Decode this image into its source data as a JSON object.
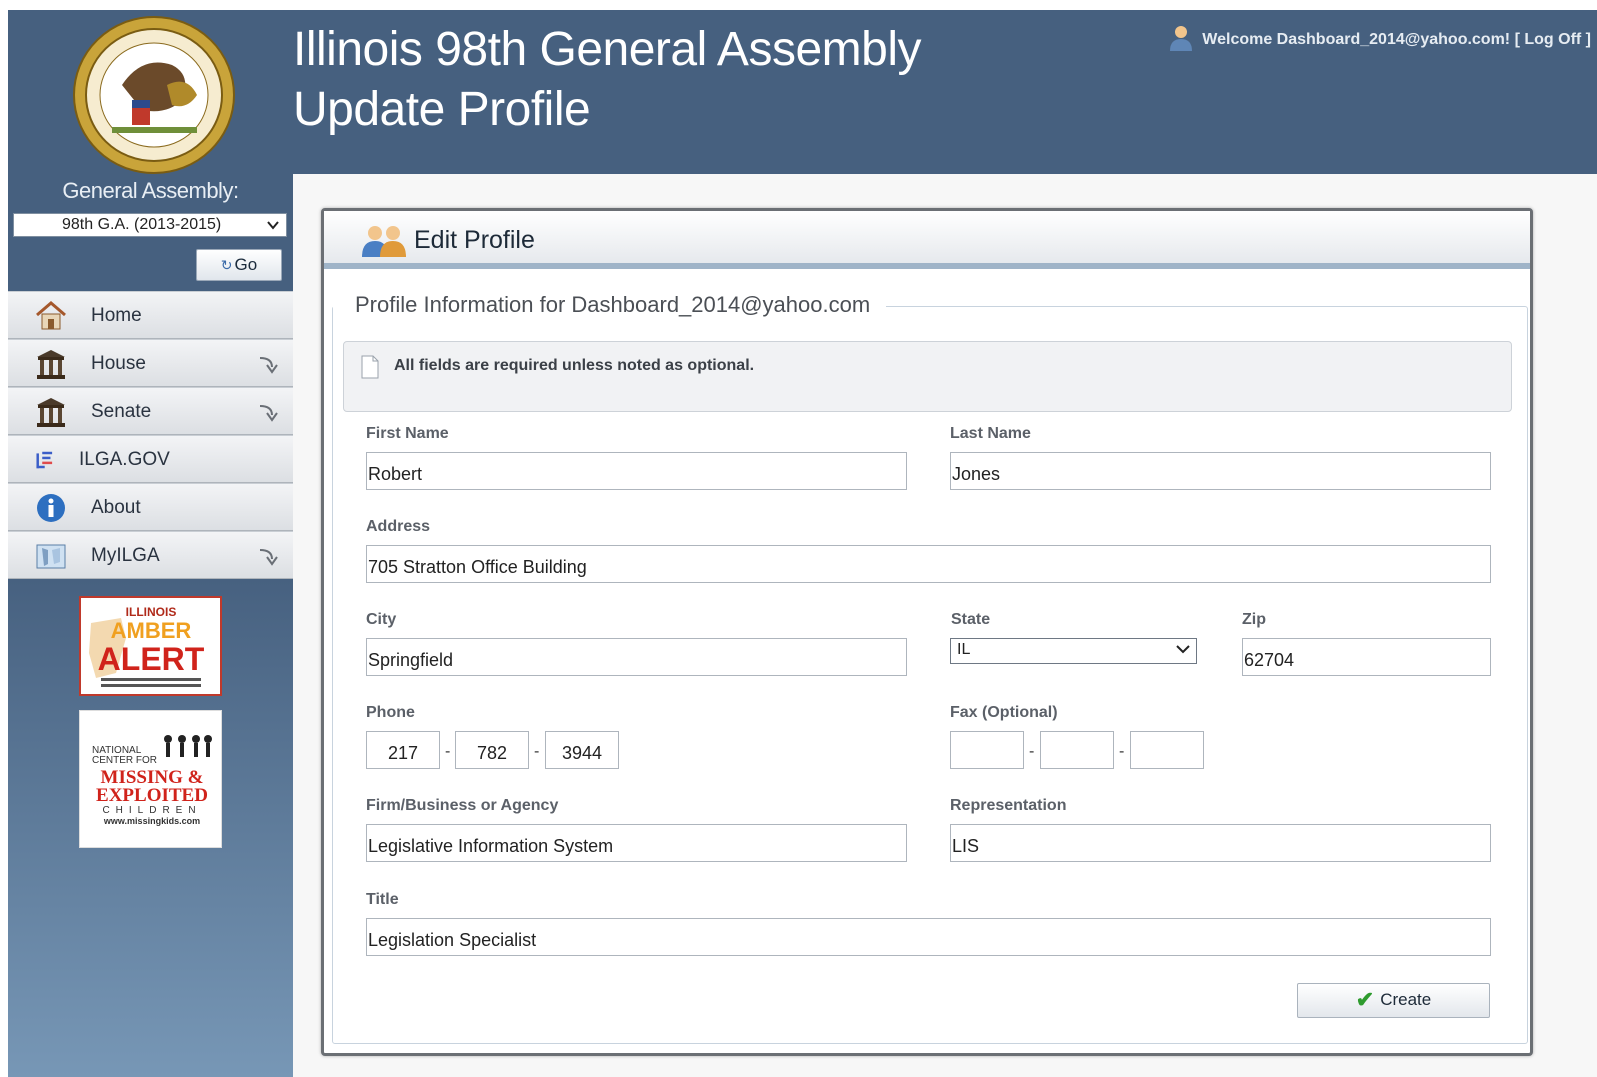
{
  "header": {
    "title_line1": "Illinois 98th General Assembly",
    "title_line2": "Update Profile",
    "welcome_text": "Welcome Dashboard_2014@yahoo.com! [ Log Off ]"
  },
  "sidebar": {
    "ga_label": "General Assembly:",
    "ga_selected": "98th G.A. (2013-2015)",
    "go_label": "Go",
    "nav": [
      {
        "label": "Home",
        "icon": "home-icon",
        "expandable": false
      },
      {
        "label": "House",
        "icon": "capitol-building-icon",
        "expandable": true
      },
      {
        "label": "Senate",
        "icon": "capitol-building-icon",
        "expandable": true
      },
      {
        "label": "ILGA.GOV",
        "icon": "ilga-logo-icon",
        "expandable": false
      },
      {
        "label": "About",
        "icon": "info-icon",
        "expandable": false
      },
      {
        "label": "MyILGA",
        "icon": "map-icon",
        "expandable": true
      }
    ],
    "amber_alert": {
      "line1": "ILLINOIS",
      "line2": "AMBER",
      "line3": "ALERT"
    },
    "missing_kids": {
      "line1": "NATIONAL",
      "line2": "CENTER FOR",
      "line3": "MISSING &",
      "line4": "EXPLOITED",
      "line5": "CHILDREN",
      "url": "www.missingkids.com"
    }
  },
  "panel": {
    "title": "Edit Profile",
    "legend": "Profile Information for Dashboard_2014@yahoo.com",
    "notice": "All fields are required unless noted as optional."
  },
  "form": {
    "first_name": {
      "label": "First Name",
      "value": "Robert"
    },
    "last_name": {
      "label": "Last Name",
      "value": "Jones"
    },
    "address": {
      "label": "Address",
      "value": "705 Stratton Office Building"
    },
    "city": {
      "label": "City",
      "value": "Springfield"
    },
    "state": {
      "label": "State",
      "value": "IL"
    },
    "zip": {
      "label": "Zip",
      "value": "62704"
    },
    "phone": {
      "label": "Phone",
      "area": "217",
      "prefix": "782",
      "line": "3944"
    },
    "fax": {
      "label": "Fax (Optional)",
      "area": "",
      "prefix": "",
      "line": ""
    },
    "firm": {
      "label": "Firm/Business or Agency",
      "value": "Legislative Information System"
    },
    "representation": {
      "label": "Representation",
      "value": "LIS"
    },
    "title": {
      "label": "Title",
      "value": "Legislation Specialist"
    },
    "separator": "-",
    "create_label": "Create"
  },
  "colors": {
    "header_bg": "#46607f",
    "accent": "#9fb4c8",
    "check": "#2e9b2e"
  }
}
